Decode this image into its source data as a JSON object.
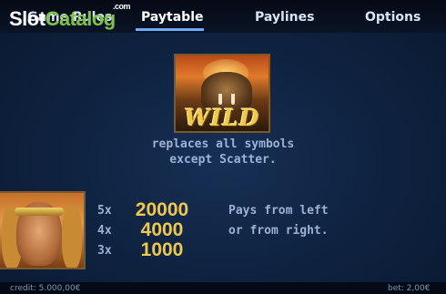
{
  "logo": {
    "slot": "Slot",
    "catalog": "Catalog",
    "com": ".com"
  },
  "nav": {
    "tabs": [
      {
        "label": "Game Rules",
        "active": false
      },
      {
        "label": "Paytable",
        "active": true
      },
      {
        "label": "Paylines",
        "active": false
      },
      {
        "label": "Options",
        "active": false
      }
    ]
  },
  "wild": {
    "symbol_label": "WILD",
    "description_line1": "replaces all symbols",
    "description_line2": "except Scatter."
  },
  "hero": {
    "rows": [
      {
        "multiplier": "5x",
        "payout": "20000"
      },
      {
        "multiplier": "4x",
        "payout": "4000"
      },
      {
        "multiplier": "3x",
        "payout": "1000"
      }
    ],
    "pays_line1": "Pays from left",
    "pays_line2": "or from right."
  },
  "footer": {
    "credit": "credit: 5.000,00€",
    "bet": "bet: 2,00€"
  },
  "colors": {
    "payout": "#f2c84a",
    "text": "#9ab2d6",
    "accent": "#6fa8ff",
    "logo_green": "#7ec24a"
  }
}
